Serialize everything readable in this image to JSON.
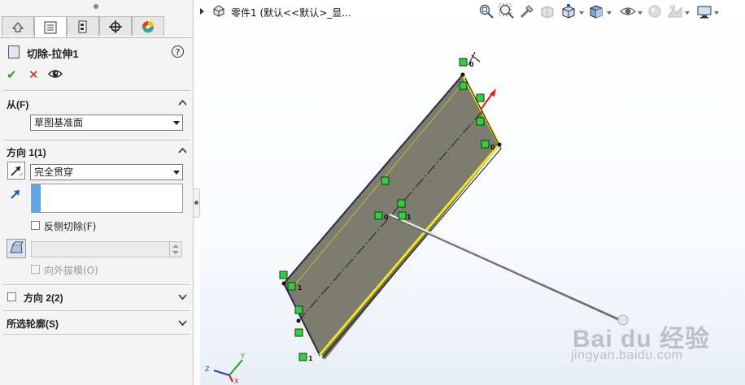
{
  "panel": {
    "tabs": [
      {
        "icon": "feature-manager-icon",
        "glyph": "⚙"
      },
      {
        "icon": "property-manager-icon",
        "glyph": "☰"
      },
      {
        "icon": "configuration-manager-icon",
        "glyph": "⊞"
      },
      {
        "icon": "dimxpert-icon",
        "glyph": "⌖"
      },
      {
        "icon": "display-manager-icon",
        "glyph": "●"
      }
    ],
    "active_tab_index": 1,
    "feature_title": "切除-拉伸1",
    "help_glyph": "?",
    "ok_glyph": "✔",
    "cancel_glyph": "✕",
    "from": {
      "header": "从(F)",
      "value": "草图基准面"
    },
    "direction1": {
      "header": "方向 1(1)",
      "end_condition": "完全贯穿",
      "flip_side_label": "反侧切除(F)",
      "flip_side_checked": false,
      "draft_outward_label": "向外拔模(O)",
      "draft_outward_checked": false,
      "draft_enabled": false
    },
    "direction2": {
      "header": "方向 2(2)",
      "checked": false
    },
    "selected_contours": {
      "header": "所选轮廓(S)"
    }
  },
  "viewport": {
    "breadcrumb": "零件1  (默认<<默认>_显...",
    "hud_icons": [
      "zoom-to-fit-icon",
      "zoom-to-area-icon",
      "previous-view-icon",
      "section-view-icon",
      "view-orientation-icon",
      "display-style-icon",
      "hide-show-items-icon",
      "edit-appearance-icon",
      "apply-scene-icon",
      "view-settings-icon"
    ],
    "sketch_labels": {
      "near_top": "0",
      "near_right": "0",
      "near_center_a": "0",
      "near_center_b": "1",
      "left_mid": "1",
      "bottom": "1"
    },
    "triad": {
      "x": "X",
      "y": "Y",
      "z": "Z"
    }
  },
  "watermark": {
    "logo": "Bai du 经验",
    "url": "jingyan.baidu.com"
  },
  "colors": {
    "plane_fill": "#7a7b6c",
    "edge_highlight": "#f2e51c",
    "relation_green": "#2fcf3f",
    "accent_blue": "#55a6ee",
    "arrow_red": "#e31b1b"
  }
}
